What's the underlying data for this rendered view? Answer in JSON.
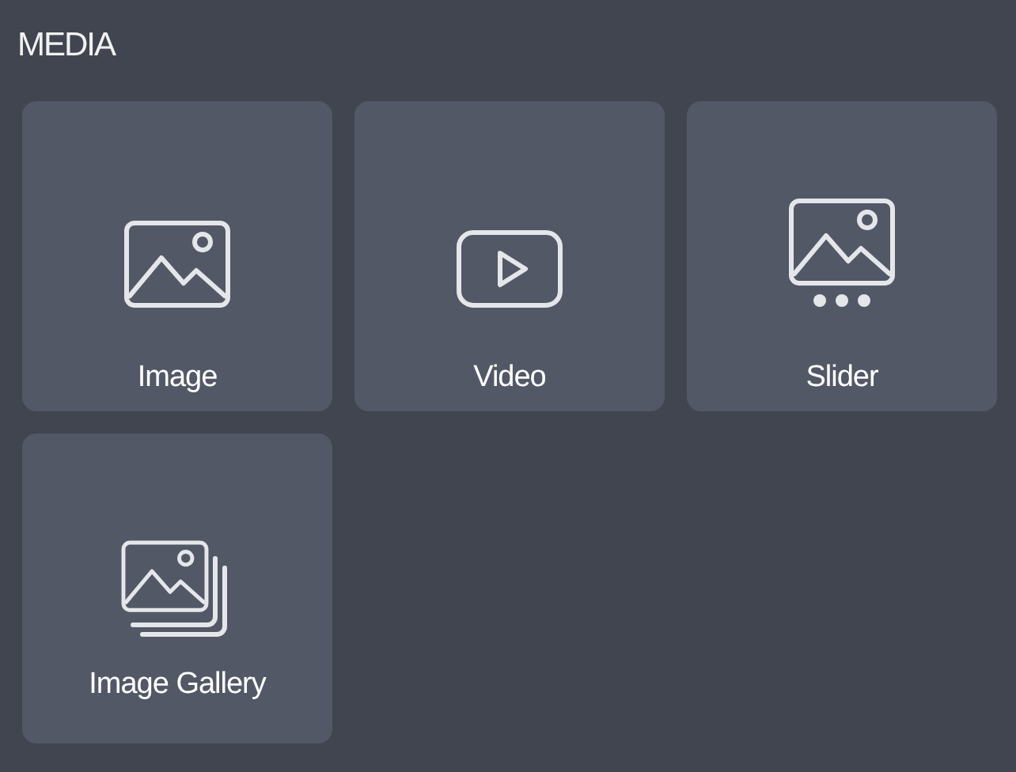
{
  "section": {
    "title": "MEDIA"
  },
  "items": [
    {
      "label": "Image",
      "kind": "image"
    },
    {
      "label": "Video",
      "kind": "video"
    },
    {
      "label": "Slider",
      "kind": "slider"
    },
    {
      "label": "Image Gallery",
      "kind": "gallery"
    }
  ]
}
